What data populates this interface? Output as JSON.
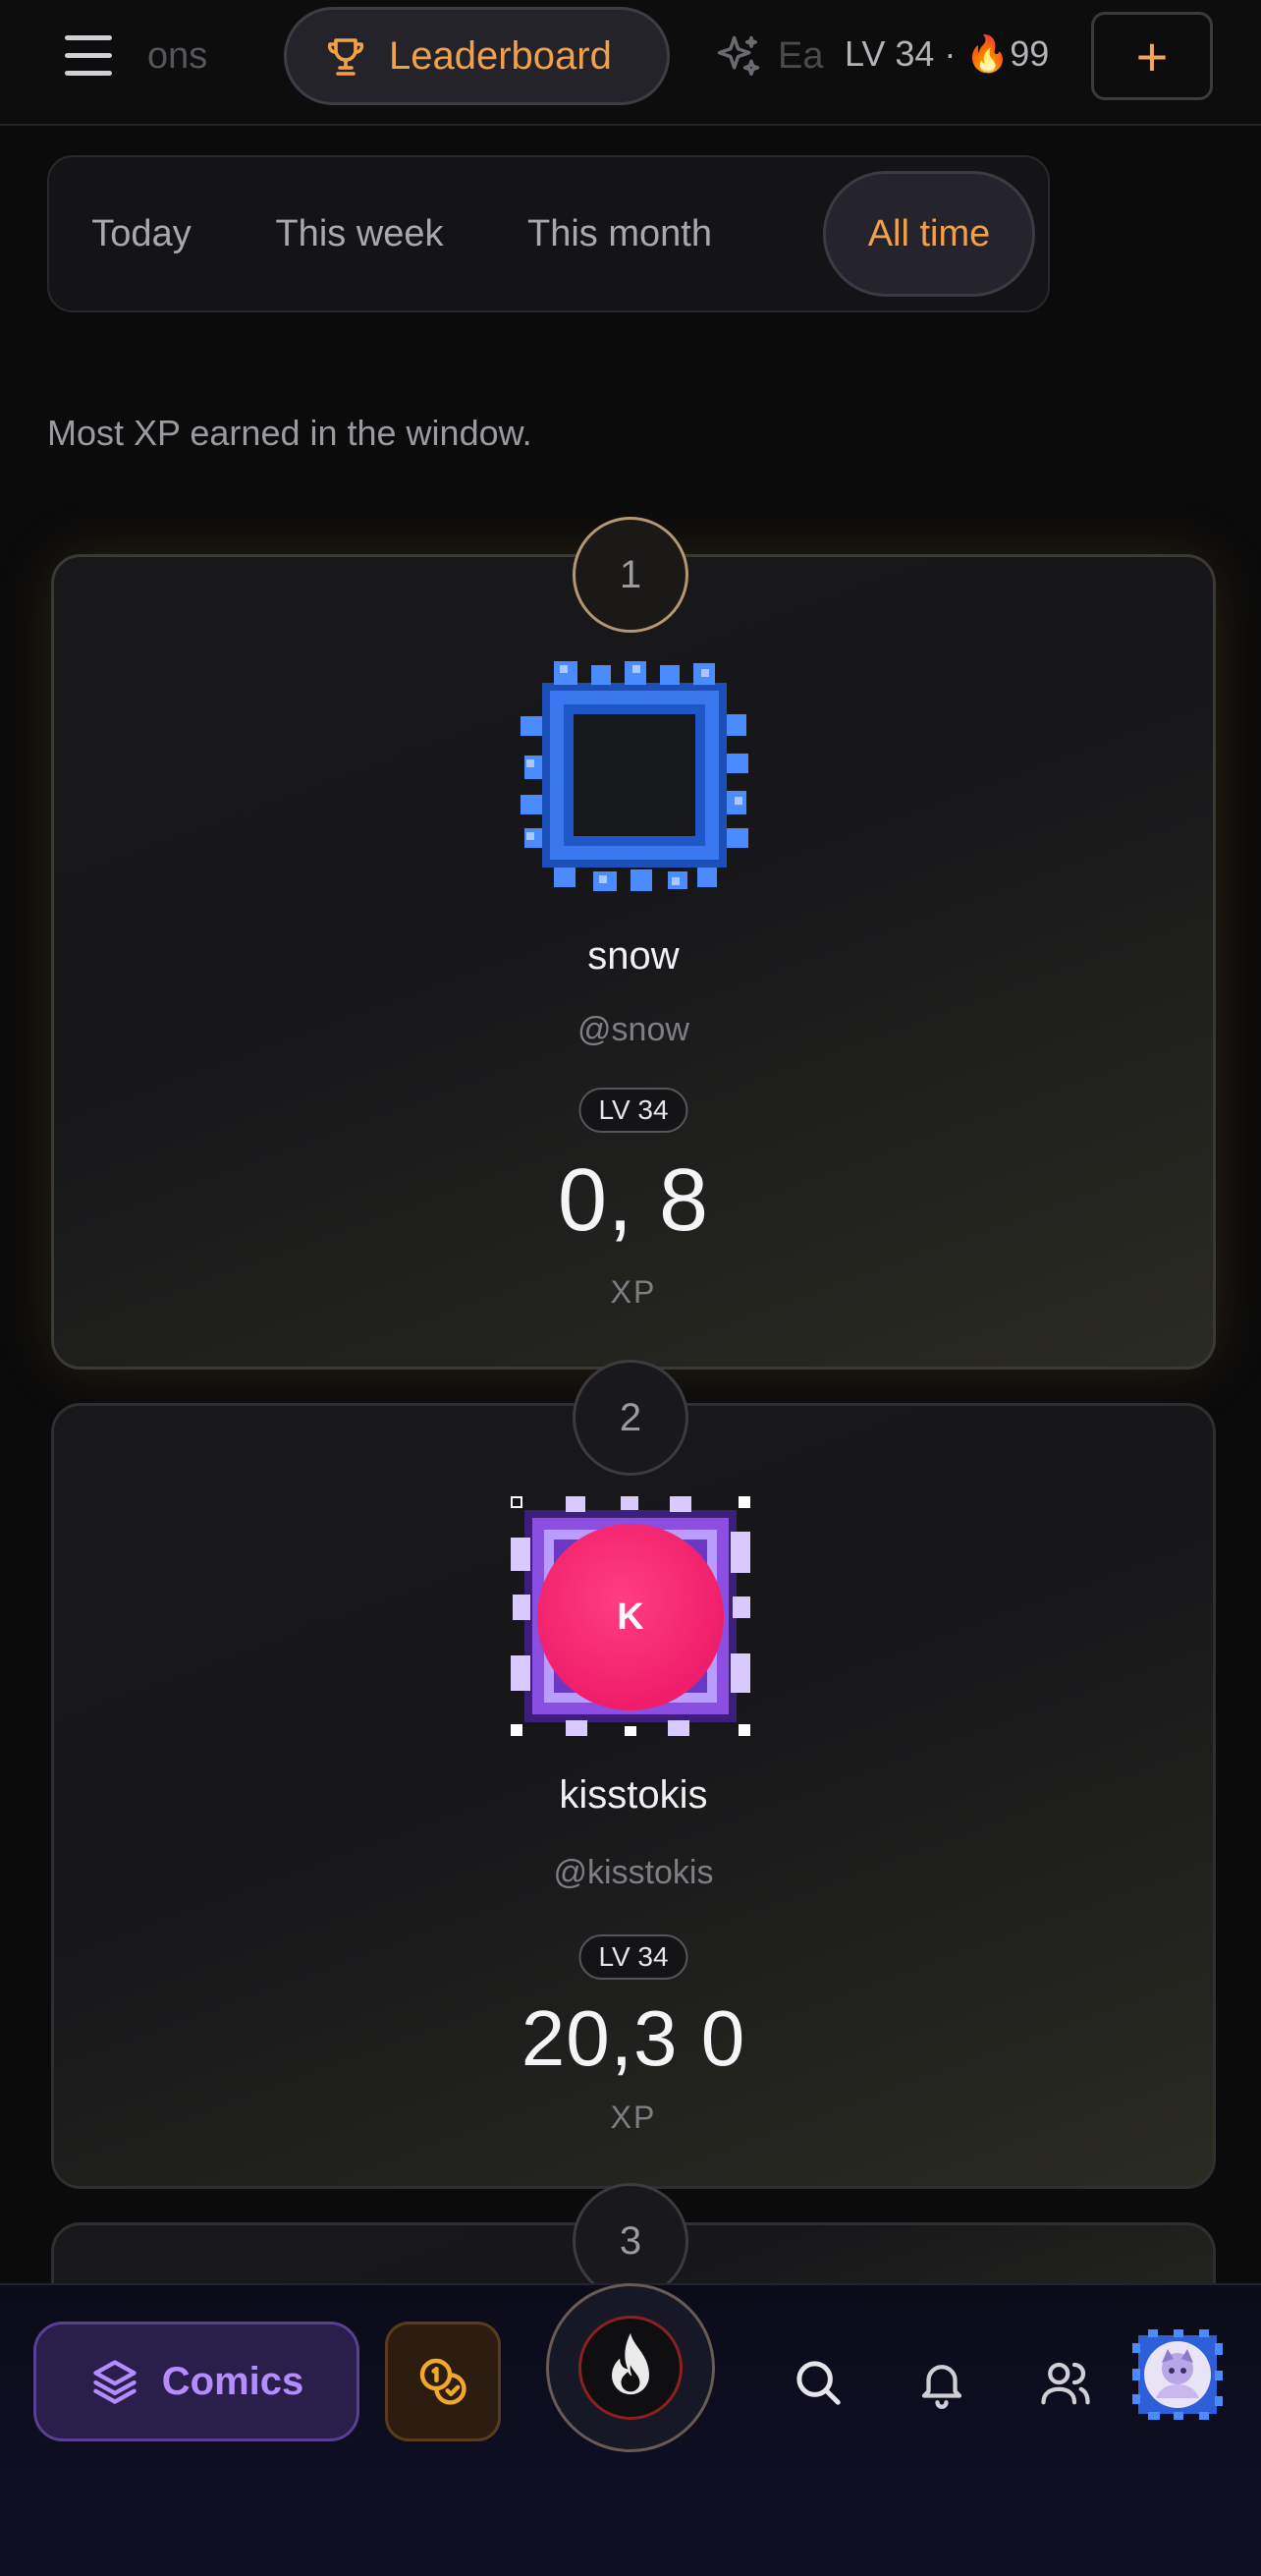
{
  "topbar": {
    "prev_tab_fragment": "ons",
    "active_tab": "Leaderboard",
    "next_tab_fragment": "Ea",
    "level_streak": "LV 34 · 🔥99",
    "plus_label": "+"
  },
  "periods": {
    "tabs": [
      "Today",
      "This week",
      "This month",
      "All time"
    ],
    "active": "All time"
  },
  "subtitle": "Most XP earned in the window.",
  "entries": [
    {
      "rank": "1",
      "name": "snow",
      "handle": "@snow",
      "level": "LV 34",
      "xp": "0,   8",
      "xp_label": "XP",
      "frame_color": "#3a78f0"
    },
    {
      "rank": "2",
      "name": "kisstokis",
      "handle": "@kisstokis",
      "level": "LV 34",
      "xp": "20,3  0",
      "xp_label": "XP",
      "avatar_initial": "K",
      "avatar_color": "#f01e6a",
      "frame_color": "#8a4fe0"
    },
    {
      "rank": "3"
    }
  ],
  "bottom_nav": {
    "comics_label": "Comics",
    "icons": [
      "layers-icon",
      "coins-icon",
      "flame-icon",
      "search-icon",
      "bell-icon",
      "users-icon",
      "profile-avatar"
    ]
  },
  "colors": {
    "accent_orange": "#f2a14a",
    "accent_purple": "#b48cff",
    "background": "#0b0b0c"
  }
}
